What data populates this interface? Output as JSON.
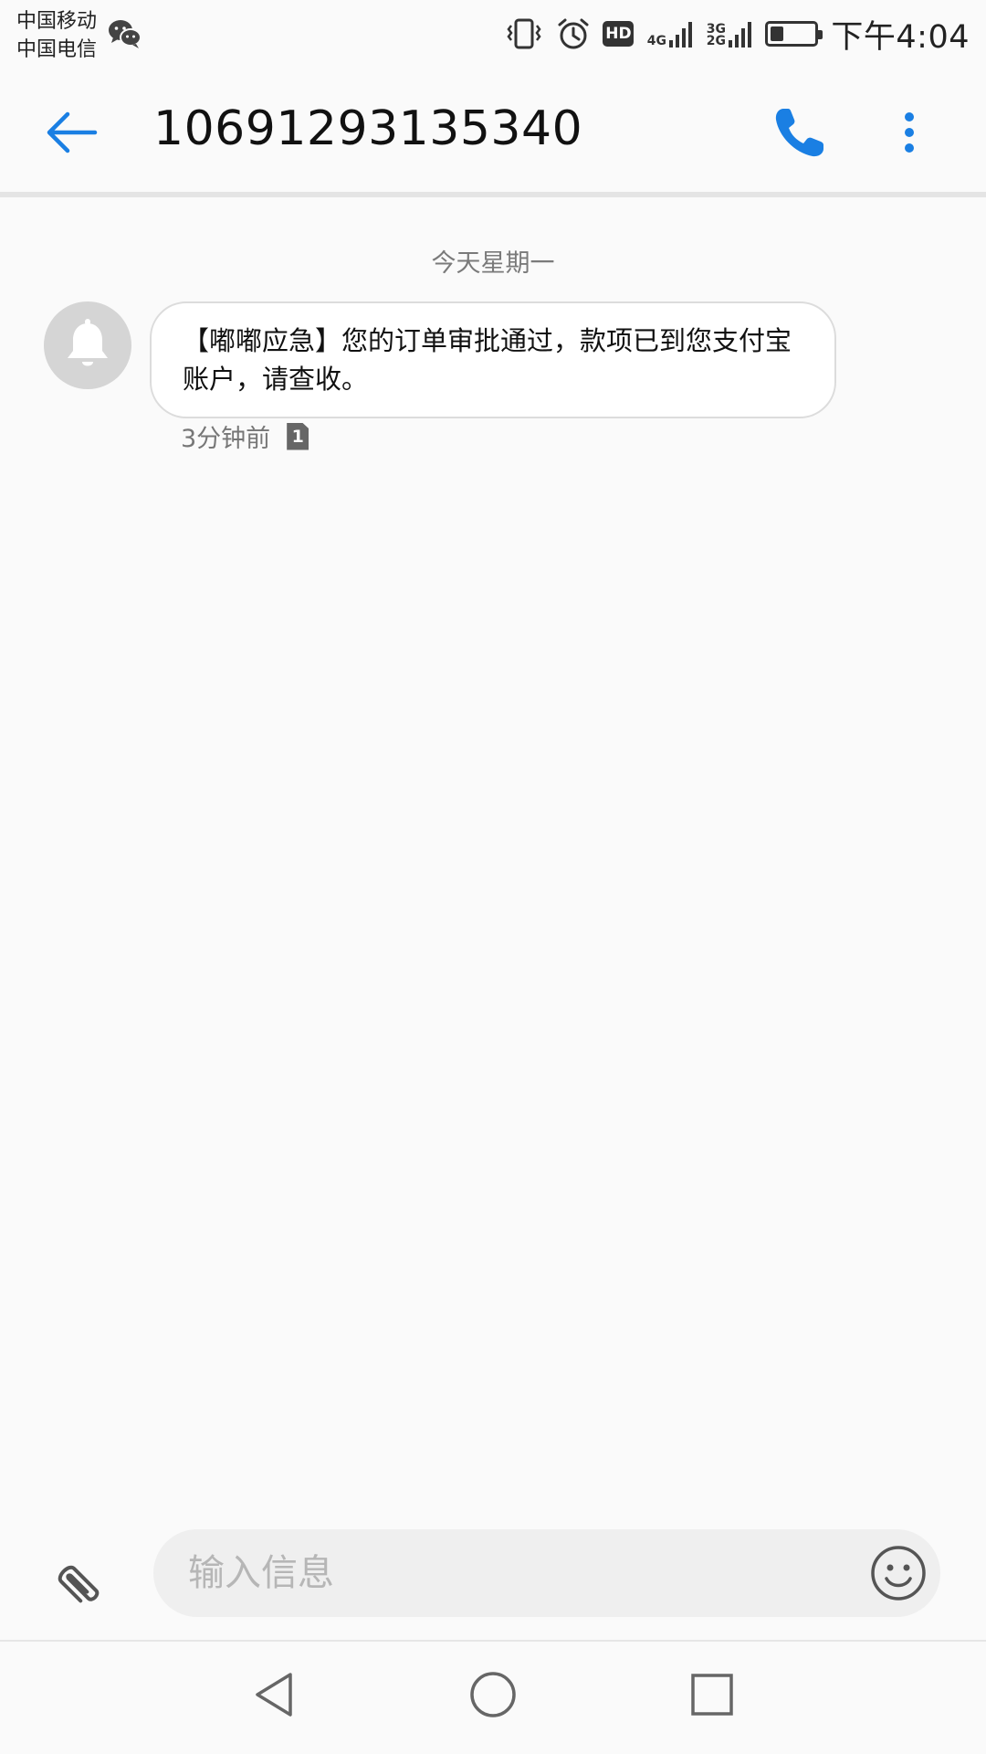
{
  "status_bar": {
    "carrier_1": "中国移动",
    "carrier_2": "中国电信",
    "net_1": "4G",
    "net_2": "3G 2G",
    "hd_label": "HD",
    "battery_level": 0.3,
    "time": "下午4:04"
  },
  "header": {
    "title": "10691293135340",
    "icons": [
      "back-arrow-icon",
      "phone-icon",
      "more-vert-icon"
    ],
    "accent_color": "#1a7fe3"
  },
  "conversation": {
    "date_label": "今天星期一",
    "messages": [
      {
        "text": "【嘟嘟应急】您的订单审批通过，款项已到您支付宝账户，请查收。",
        "time": "3分钟前",
        "sim": "1"
      }
    ]
  },
  "composer": {
    "placeholder": "输入信息"
  },
  "nav": {
    "icons": [
      "back-triangle-icon",
      "home-circle-icon",
      "recents-square-icon"
    ]
  }
}
